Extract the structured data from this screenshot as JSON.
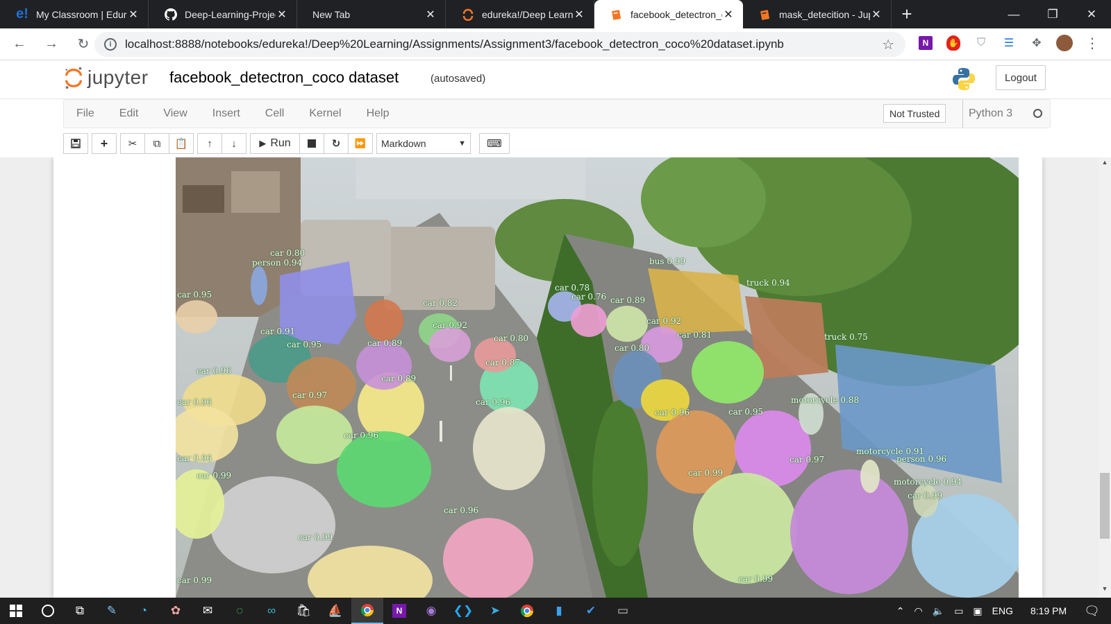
{
  "browser": {
    "tabs": [
      {
        "title": "My Classroom | Edureka",
        "favicon": "edureka-icon",
        "favicon_color": "#1f6fd6",
        "active": false
      },
      {
        "title": "Deep-Learning-Projects",
        "favicon": "github-icon",
        "favicon_color": "#ffffff",
        "active": false
      },
      {
        "title": "New Tab",
        "favicon": "",
        "favicon_color": "",
        "active": false
      },
      {
        "title": "edureka!/Deep Learning",
        "favicon": "jupyter-icon",
        "favicon_color": "#f37626",
        "active": false
      },
      {
        "title": "facebook_detectron_coco",
        "favicon": "notebook-icon",
        "favicon_color": "#f37626",
        "active": true
      },
      {
        "title": "mask_detecition - Jupyter",
        "favicon": "notebook-icon",
        "favicon_color": "#f37626",
        "active": false
      }
    ],
    "url": "localhost:8888/notebooks/edureka!/Deep%20Learning/Assignments/Assignment3/facebook_detectron_coco%20dataset.ipynb"
  },
  "jupyter": {
    "logo_text": "jupyter",
    "notebook_title": "facebook_detectron_coco dataset",
    "autosave_status": "(autosaved)",
    "logout_label": "Logout",
    "menu": [
      "File",
      "Edit",
      "View",
      "Insert",
      "Cell",
      "Kernel",
      "Help"
    ],
    "trust_status": "Not Trusted",
    "kernel": "Python 3",
    "toolbar": {
      "run_label": "Run",
      "cell_type": "Markdown"
    }
  },
  "figure": {
    "detections": [
      {
        "label": "car 0.80"
      },
      {
        "label": "person 0.94"
      },
      {
        "label": "car 0.95"
      },
      {
        "label": "car 0.91"
      },
      {
        "label": "car 0.95"
      },
      {
        "label": "car 0.96"
      },
      {
        "label": "car 0.96"
      },
      {
        "label": "car 0.97"
      },
      {
        "label": "car 0.96"
      },
      {
        "label": "car 0.99"
      },
      {
        "label": "car 0.99"
      },
      {
        "label": "car 0.99"
      },
      {
        "label": "car 0.82"
      },
      {
        "label": "car 0.92"
      },
      {
        "label": "car 0.89"
      },
      {
        "label": "car 0.89"
      },
      {
        "label": "car 0.80"
      },
      {
        "label": "car 0.87"
      },
      {
        "label": "car 0.96"
      },
      {
        "label": "car 0.96"
      },
      {
        "label": "car 0.96"
      },
      {
        "label": "bus 0.99"
      },
      {
        "label": "car 0.78"
      },
      {
        "label": "car 0.76"
      },
      {
        "label": "car 0.89"
      },
      {
        "label": "car 0.92"
      },
      {
        "label": "car 0.80"
      },
      {
        "label": "car 0.81"
      },
      {
        "label": "truck 0.94"
      },
      {
        "label": "truck 0.75"
      },
      {
        "label": "car 0.96"
      },
      {
        "label": "car 0.95"
      },
      {
        "label": "motorcycle 0.88"
      },
      {
        "label": "car 0.97"
      },
      {
        "label": "car 0.99"
      },
      {
        "label": "motorcycle 0.91"
      },
      {
        "label": "person 0.96"
      },
      {
        "label": "motorcycle 0.94"
      },
      {
        "label": "car 0.99"
      },
      {
        "label": "car 0.99"
      }
    ]
  },
  "taskbar": {
    "language": "ENG",
    "time": "8:19 PM"
  }
}
